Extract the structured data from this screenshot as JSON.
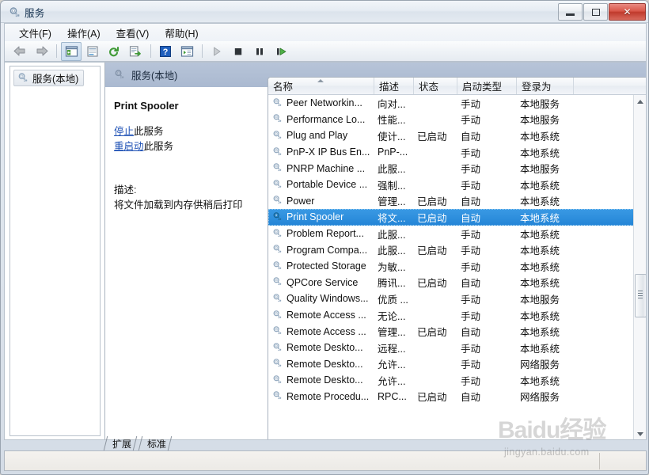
{
  "window": {
    "title": "服务",
    "title_icon": "services-gear-icon",
    "controls": {
      "minimize": "minimize-icon",
      "restore": "restore-icon",
      "close": "✕"
    }
  },
  "menu": {
    "items": [
      {
        "label": "文件(F)",
        "name": "menu-file"
      },
      {
        "label": "操作(A)",
        "name": "menu-action"
      },
      {
        "label": "查看(V)",
        "name": "menu-view"
      },
      {
        "label": "帮助(H)",
        "name": "menu-help"
      }
    ]
  },
  "toolbar": {
    "buttons": [
      {
        "name": "back-arrow-icon",
        "glyph": "back"
      },
      {
        "name": "forward-arrow-icon",
        "glyph": "forward"
      },
      {
        "name": "show-hide-tree-icon",
        "glyph": "tree",
        "pressed": true
      },
      {
        "name": "properties-icon",
        "glyph": "props"
      },
      {
        "name": "refresh-icon",
        "glyph": "refresh"
      },
      {
        "name": "export-list-icon",
        "glyph": "export"
      },
      {
        "name": "help-icon",
        "glyph": "help"
      },
      {
        "name": "list-view-icon",
        "glyph": "listview"
      },
      {
        "name": "start-service-icon",
        "glyph": "play"
      },
      {
        "name": "stop-service-icon",
        "glyph": "stop"
      },
      {
        "name": "pause-service-icon",
        "glyph": "pause"
      },
      {
        "name": "restart-service-icon",
        "glyph": "restart"
      }
    ]
  },
  "tree": {
    "root_label": "服务(本地)",
    "root_icon": "services-gear-icon"
  },
  "banner": {
    "label": "服务(本地)",
    "icon": "services-gear-icon"
  },
  "detail": {
    "service_name": "Print Spooler",
    "stop_link": "停止",
    "stop_suffix": "此服务",
    "restart_link": "重启动",
    "restart_suffix": "此服务",
    "description_label": "描述:",
    "description_text": "将文件加载到内存供稍后打印"
  },
  "list": {
    "columns": [
      {
        "label": "名称",
        "name": "column-name",
        "sorted": "asc"
      },
      {
        "label": "描述",
        "name": "column-description"
      },
      {
        "label": "状态",
        "name": "column-status"
      },
      {
        "label": "启动类型",
        "name": "column-startup-type"
      },
      {
        "label": "登录为",
        "name": "column-log-on-as"
      }
    ],
    "rows": [
      {
        "name": "Peer Networkin...",
        "desc": "向对...",
        "status": "",
        "startup": "手动",
        "logon": "本地服务",
        "selected": false
      },
      {
        "name": "Performance Lo...",
        "desc": "性能...",
        "status": "",
        "startup": "手动",
        "logon": "本地服务",
        "selected": false
      },
      {
        "name": "Plug and Play",
        "desc": "使计...",
        "status": "已启动",
        "startup": "自动",
        "logon": "本地系统",
        "selected": false
      },
      {
        "name": "PnP-X IP Bus En...",
        "desc": "PnP-...",
        "status": "",
        "startup": "手动",
        "logon": "本地系统",
        "selected": false
      },
      {
        "name": "PNRP Machine ...",
        "desc": "此服...",
        "status": "",
        "startup": "手动",
        "logon": "本地服务",
        "selected": false
      },
      {
        "name": "Portable Device ...",
        "desc": "强制...",
        "status": "",
        "startup": "手动",
        "logon": "本地系统",
        "selected": false
      },
      {
        "name": "Power",
        "desc": "管理...",
        "status": "已启动",
        "startup": "自动",
        "logon": "本地系统",
        "selected": false
      },
      {
        "name": "Print Spooler",
        "desc": "将文...",
        "status": "已启动",
        "startup": "自动",
        "logon": "本地系统",
        "selected": true
      },
      {
        "name": "Problem Report...",
        "desc": "此服...",
        "status": "",
        "startup": "手动",
        "logon": "本地系统",
        "selected": false
      },
      {
        "name": "Program Compa...",
        "desc": "此服...",
        "status": "已启动",
        "startup": "手动",
        "logon": "本地系统",
        "selected": false
      },
      {
        "name": "Protected Storage",
        "desc": "为敏...",
        "status": "",
        "startup": "手动",
        "logon": "本地系统",
        "selected": false
      },
      {
        "name": "QPCore Service",
        "desc": "腾讯...",
        "status": "已启动",
        "startup": "自动",
        "logon": "本地系统",
        "selected": false
      },
      {
        "name": "Quality Windows...",
        "desc": "优质 ...",
        "status": "",
        "startup": "手动",
        "logon": "本地服务",
        "selected": false
      },
      {
        "name": "Remote Access ...",
        "desc": "无论...",
        "status": "",
        "startup": "手动",
        "logon": "本地系统",
        "selected": false
      },
      {
        "name": "Remote Access ...",
        "desc": "管理...",
        "status": "已启动",
        "startup": "自动",
        "logon": "本地系统",
        "selected": false
      },
      {
        "name": "Remote Deskto...",
        "desc": "远程...",
        "status": "",
        "startup": "手动",
        "logon": "本地系统",
        "selected": false
      },
      {
        "name": "Remote Deskto...",
        "desc": "允许...",
        "status": "",
        "startup": "手动",
        "logon": "网络服务",
        "selected": false
      },
      {
        "name": "Remote Deskto...",
        "desc": "允许...",
        "status": "",
        "startup": "手动",
        "logon": "本地系统",
        "selected": false
      },
      {
        "name": "Remote Procedu...",
        "desc": "RPC...",
        "status": "已启动",
        "startup": "自动",
        "logon": "网络服务",
        "selected": false
      }
    ]
  },
  "tabs": [
    {
      "label": "扩展",
      "name": "tab-extended",
      "active": true
    },
    {
      "label": "标准",
      "name": "tab-standard",
      "active": false
    }
  ],
  "statusbar": {
    "text": ""
  },
  "watermark": {
    "logo": "Baidu经验",
    "url": "jingyan.baidu.com"
  },
  "colors": {
    "selection": "#2384d6",
    "link": "#1c4fb4",
    "banner": "#aab9d0",
    "close_button": "#c03a2c"
  }
}
